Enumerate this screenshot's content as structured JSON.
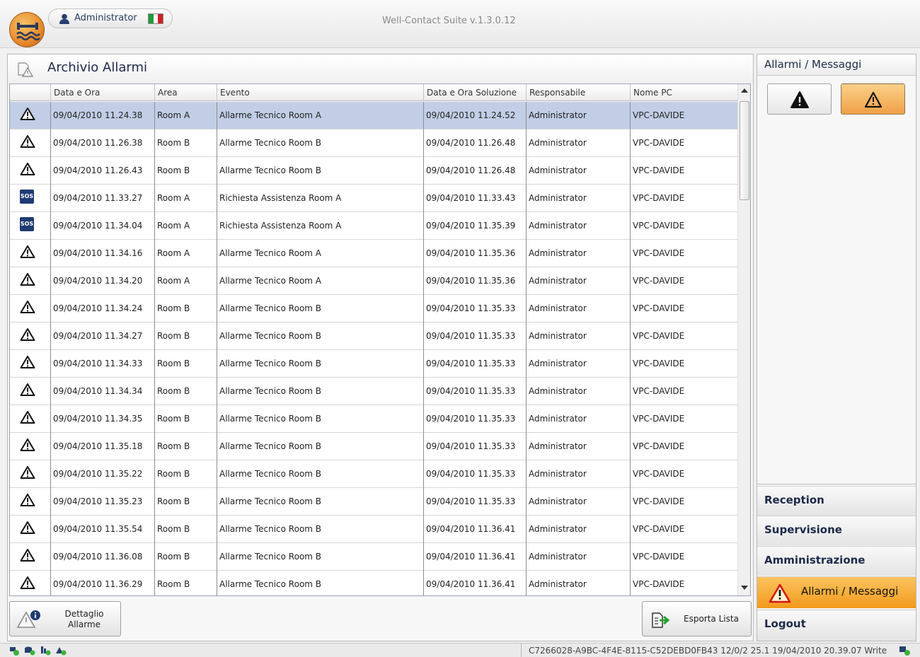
{
  "titlebar": {
    "user": "Administrator",
    "app_title": "Well-Contact Suite v.1.3.0.12"
  },
  "panel": {
    "title": "Archivio Allarmi"
  },
  "grid": {
    "columns": [
      "",
      "Data e Ora",
      "Area",
      "Evento",
      "Data e Ora Soluzione",
      "Responsabile",
      "Nome PC"
    ],
    "rows": [
      {
        "icon": "warning-icon",
        "data": "09/04/2010 11.24.38",
        "area": "Room A",
        "evento": "Allarme Tecnico Room A",
        "soluzione": "09/04/2010 11.24.52",
        "resp": "Administrator",
        "pc": "VPC-DAVIDE"
      },
      {
        "icon": "warning-icon",
        "data": "09/04/2010 11.26.38",
        "area": "Room B",
        "evento": "Allarme Tecnico Room B",
        "soluzione": "09/04/2010 11.26.48",
        "resp": "Administrator",
        "pc": "VPC-DAVIDE"
      },
      {
        "icon": "warning-icon",
        "data": "09/04/2010 11.26.43",
        "area": "Room B",
        "evento": "Allarme Tecnico Room B",
        "soluzione": "09/04/2010 11.26.48",
        "resp": "Administrator",
        "pc": "VPC-DAVIDE"
      },
      {
        "icon": "sos-icon",
        "data": "09/04/2010 11.33.27",
        "area": "Room A",
        "evento": " Richiesta Assistenza Room A",
        "soluzione": "09/04/2010 11.33.43",
        "resp": "Administrator",
        "pc": "VPC-DAVIDE"
      },
      {
        "icon": "sos-icon",
        "data": "09/04/2010 11.34.04",
        "area": "Room A",
        "evento": " Richiesta Assistenza Room A",
        "soluzione": "09/04/2010 11.35.39",
        "resp": "Administrator",
        "pc": "VPC-DAVIDE"
      },
      {
        "icon": "warning-icon",
        "data": "09/04/2010 11.34.16",
        "area": "Room A",
        "evento": "Allarme Tecnico Room A",
        "soluzione": "09/04/2010 11.35.36",
        "resp": "Administrator",
        "pc": "VPC-DAVIDE"
      },
      {
        "icon": "warning-icon",
        "data": "09/04/2010 11.34.20",
        "area": "Room A",
        "evento": "Allarme Tecnico Room A",
        "soluzione": "09/04/2010 11.35.36",
        "resp": "Administrator",
        "pc": "VPC-DAVIDE"
      },
      {
        "icon": "warning-icon",
        "data": "09/04/2010 11.34.24",
        "area": "Room B",
        "evento": "Allarme Tecnico Room B",
        "soluzione": "09/04/2010 11.35.33",
        "resp": "Administrator",
        "pc": "VPC-DAVIDE"
      },
      {
        "icon": "warning-icon",
        "data": "09/04/2010 11.34.27",
        "area": "Room B",
        "evento": "Allarme Tecnico Room B",
        "soluzione": "09/04/2010 11.35.33",
        "resp": "Administrator",
        "pc": "VPC-DAVIDE"
      },
      {
        "icon": "warning-icon",
        "data": "09/04/2010 11.34.33",
        "area": "Room B",
        "evento": "Allarme Tecnico Room B",
        "soluzione": "09/04/2010 11.35.33",
        "resp": "Administrator",
        "pc": "VPC-DAVIDE"
      },
      {
        "icon": "warning-icon",
        "data": "09/04/2010 11.34.34",
        "area": "Room B",
        "evento": "Allarme Tecnico Room B",
        "soluzione": "09/04/2010 11.35.33",
        "resp": "Administrator",
        "pc": "VPC-DAVIDE"
      },
      {
        "icon": "warning-icon",
        "data": "09/04/2010 11.34.35",
        "area": "Room B",
        "evento": "Allarme Tecnico Room B",
        "soluzione": "09/04/2010 11.35.33",
        "resp": "Administrator",
        "pc": "VPC-DAVIDE"
      },
      {
        "icon": "warning-icon",
        "data": "09/04/2010 11.35.18",
        "area": "Room B",
        "evento": "Allarme Tecnico Room B",
        "soluzione": "09/04/2010 11.35.33",
        "resp": "Administrator",
        "pc": "VPC-DAVIDE"
      },
      {
        "icon": "warning-icon",
        "data": "09/04/2010 11.35.22",
        "area": "Room B",
        "evento": "Allarme Tecnico Room B",
        "soluzione": "09/04/2010 11.35.33",
        "resp": "Administrator",
        "pc": "VPC-DAVIDE"
      },
      {
        "icon": "warning-icon",
        "data": "09/04/2010 11.35.23",
        "area": "Room B",
        "evento": "Allarme Tecnico Room B",
        "soluzione": "09/04/2010 11.35.33",
        "resp": "Administrator",
        "pc": "VPC-DAVIDE"
      },
      {
        "icon": "warning-icon",
        "data": "09/04/2010 11.35.54",
        "area": "Room B",
        "evento": "Allarme Tecnico Room B",
        "soluzione": "09/04/2010 11.36.41",
        "resp": "Administrator",
        "pc": "VPC-DAVIDE"
      },
      {
        "icon": "warning-icon",
        "data": "09/04/2010 11.36.08",
        "area": "Room B",
        "evento": "Allarme Tecnico Room B",
        "soluzione": "09/04/2010 11.36.41",
        "resp": "Administrator",
        "pc": "VPC-DAVIDE"
      },
      {
        "icon": "warning-icon",
        "data": "09/04/2010 11.36.29",
        "area": "Room B",
        "evento": "Allarme Tecnico Room B",
        "soluzione": "09/04/2010 11.36.41",
        "resp": "Administrator",
        "pc": "VPC-DAVIDE"
      }
    ],
    "sos_label": "SOS"
  },
  "buttons": {
    "detail_line1": "Dettaglio",
    "detail_line2": "Allarme",
    "export": "Esporta Lista"
  },
  "side": {
    "title": "Allarmi / Messaggi",
    "nav": {
      "reception": "Reception",
      "supervisione": "Supervisione",
      "amministrazione": "Amministrazione",
      "allarmi": "Allarmi / Messaggi",
      "logout": "Logout"
    }
  },
  "status": {
    "text": "C7266028-A9BC-4F4E-8115-C52DEBD0FB43 12/0/2 25.1 19/04/2010 20.39.07 Write"
  },
  "colors": {
    "accent_orange": "#f29a1c",
    "selected_row": "#c1cee6",
    "title_navy": "#1c2a48"
  }
}
